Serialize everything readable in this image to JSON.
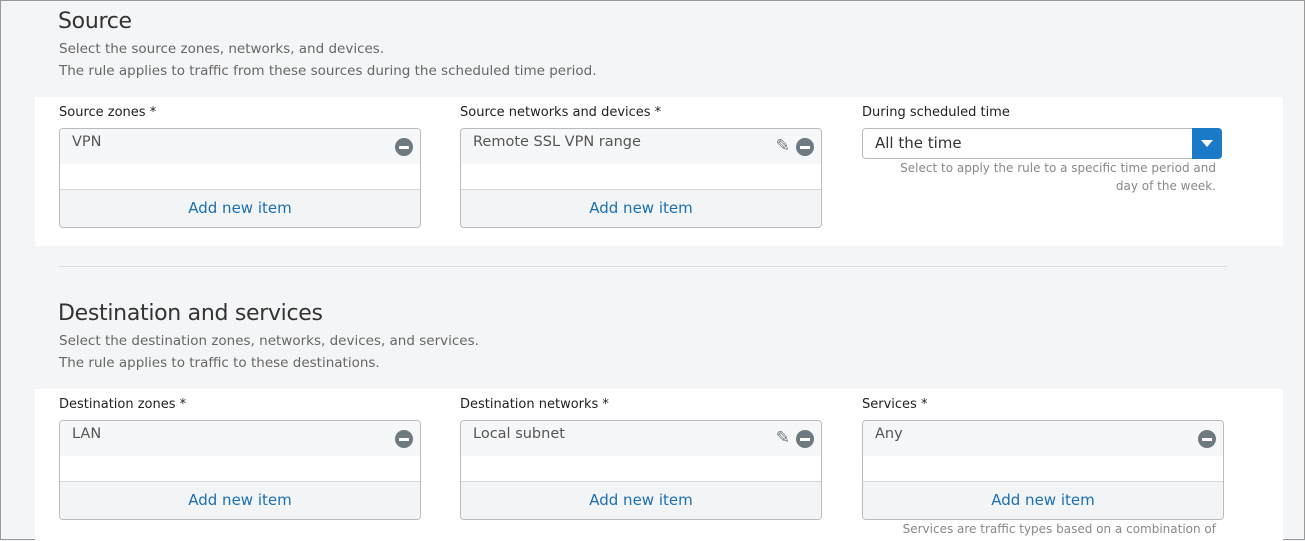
{
  "source": {
    "title": "Source",
    "desc1": "Select the source zones, networks, and devices.",
    "desc2": "The rule applies to traffic from these sources during the scheduled time period.",
    "zones": {
      "label": "Source zones *",
      "items": [
        "VPN"
      ],
      "add": "Add new item"
    },
    "networks": {
      "label": "Source networks and devices *",
      "items": [
        "Remote SSL VPN range"
      ],
      "add": "Add new item"
    },
    "schedule": {
      "label": "During scheduled time",
      "value": "All the time",
      "help": "Select to apply the rule to a specific time period and day of the week."
    }
  },
  "destination": {
    "title": "Destination and services",
    "desc1": "Select the destination zones, networks, devices, and services.",
    "desc2": "The rule applies to traffic to these destinations.",
    "zones": {
      "label": "Destination zones *",
      "items": [
        "LAN"
      ],
      "add": "Add new item"
    },
    "networks": {
      "label": "Destination networks *",
      "items": [
        "Local subnet"
      ],
      "add": "Add new item"
    },
    "services": {
      "label": "Services *",
      "items": [
        "Any"
      ],
      "add": "Add new item",
      "help": "Services are traffic types based on a combination of"
    }
  }
}
